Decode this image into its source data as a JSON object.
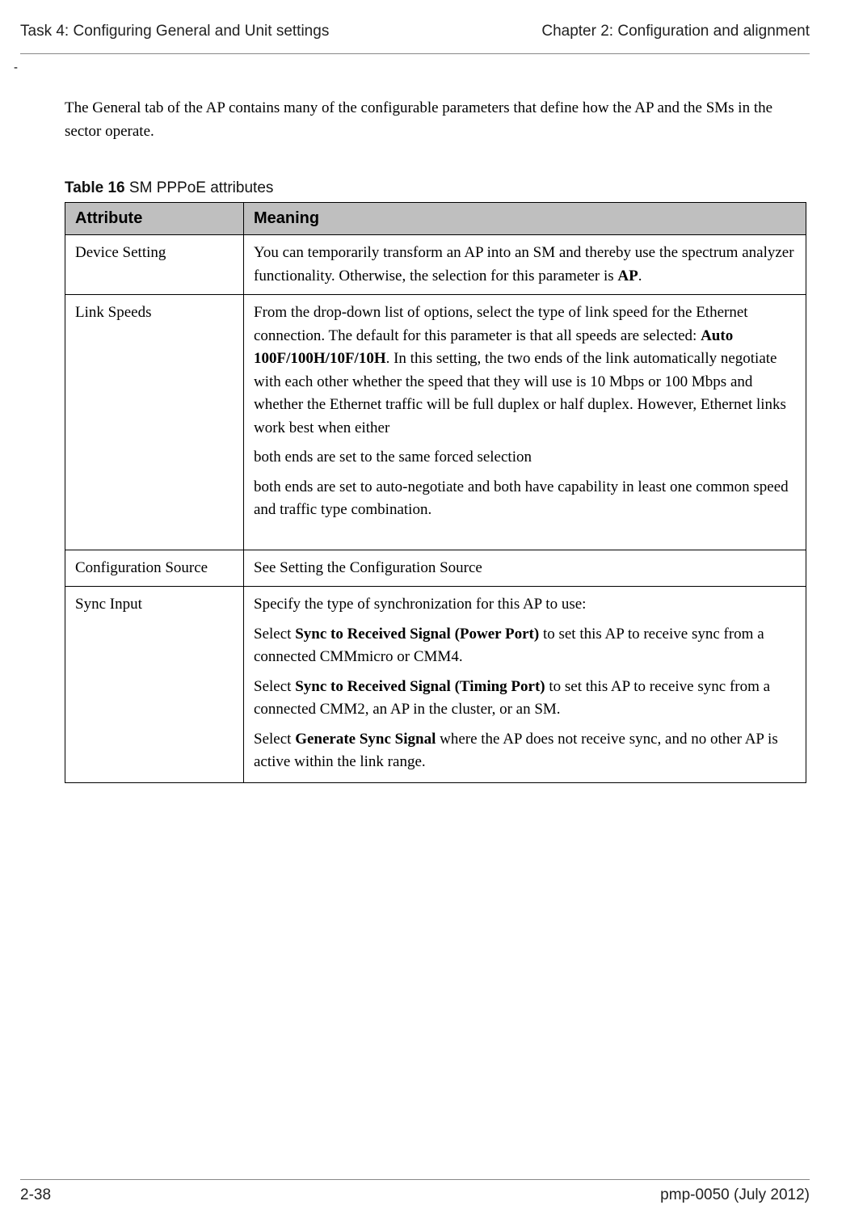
{
  "header": {
    "left": "Task 4: Configuring General and Unit settings",
    "right": "Chapter 2:  Configuration and alignment"
  },
  "dash": "-",
  "intro": "The General tab of the AP contains many of the configurable parameters that define how the AP and the SMs in the sector operate.",
  "table": {
    "caption_label": "Table 16",
    "caption_title": "  SM PPPoE attributes",
    "headers": {
      "col1": "Attribute",
      "col2": "Meaning"
    },
    "rows": {
      "r1": {
        "attr": "Device Setting",
        "meaning_prefix": "You can temporarily transform an AP into an SM and thereby use the spectrum analyzer functionality. Otherwise, the selection for this parameter is ",
        "meaning_bold": "AP",
        "meaning_suffix": "."
      },
      "r2": {
        "attr": "Link Speeds",
        "p1_prefix": "From the drop-down list of options, select the type of link speed for the Ethernet connection. The default for this parameter is that all speeds are selected: ",
        "p1_bold": "Auto 100F/100H/10F/10H",
        "p1_suffix": ". In this setting, the two ends of the link automatically negotiate with each other whether the speed that they will use is 10 Mbps or 100 Mbps and whether the Ethernet traffic will be full duplex or half duplex. However, Ethernet links work best when either",
        "p2": "both ends are set to the same forced selection",
        "p3": "both ends are set to auto-negotiate and both have capability in least one common speed and traffic type combination."
      },
      "r3": {
        "attr": "Configuration Source",
        "meaning": "See Setting the Configuration Source"
      },
      "r4": {
        "attr": "Sync Input",
        "p1": "Specify the type of synchronization for this AP to use:",
        "p2_prefix": "Select ",
        "p2_bold": "Sync to Received Signal (Power Port)",
        "p2_suffix": " to set this AP to receive sync from a connected CMMmicro or CMM4.",
        "p3_prefix": "Select ",
        "p3_bold": "Sync to Received Signal (Timing Port)",
        "p3_suffix": " to set this AP to receive sync from a connected CMM2, an AP in the cluster, or an SM.",
        "p4_prefix": "Select ",
        "p4_bold": "Generate Sync Signal",
        "p4_suffix": " where the AP does not receive sync, and no other AP is active within the link range."
      }
    }
  },
  "footer": {
    "left": "2-38",
    "right": "pmp-0050 (July 2012)"
  }
}
